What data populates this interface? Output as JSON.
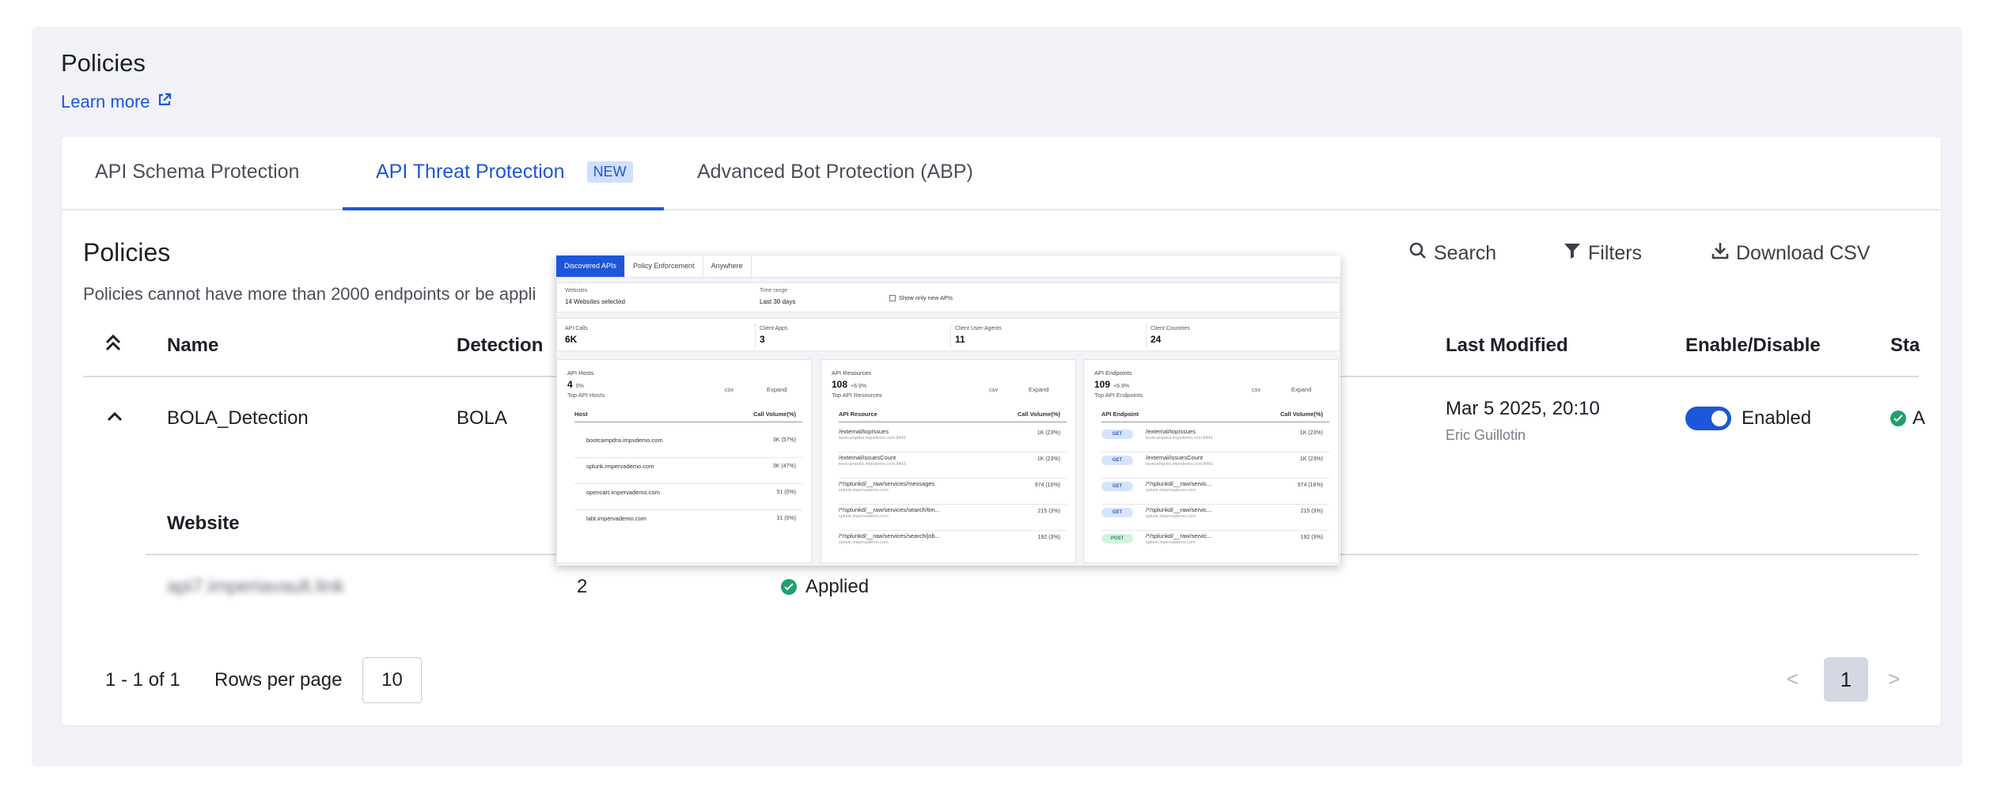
{
  "page": {
    "title": "Policies",
    "learn_more": "Learn more"
  },
  "tabs": [
    {
      "label": "API Schema Protection"
    },
    {
      "label": "API Threat Protection",
      "badge": "NEW"
    },
    {
      "label": "Advanced Bot Protection (ABP)"
    }
  ],
  "section": {
    "title": "Policies",
    "description": "Policies cannot have more than 2000 endpoints or be appli"
  },
  "toolbar": {
    "search": "Search",
    "filters": "Filters",
    "download": "Download CSV"
  },
  "table": {
    "headers": {
      "name": "Name",
      "detection": "Detection",
      "last_modified": "Last Modified",
      "enable": "Enable/Disable",
      "status": "Sta"
    },
    "row": {
      "name": "BOLA_Detection",
      "detection": "BOLA",
      "last_modified": "Mar 5 2025, 20:10",
      "modified_by": "Eric Guillotin",
      "enabled_label": "Enabled",
      "status_partial": "A"
    },
    "sub": {
      "header": "Website",
      "website": "api7.imperiavault.link",
      "count": "2",
      "status": "Applied"
    }
  },
  "pagination": {
    "range": "1 - 1 of 1",
    "rows_label": "Rows per page",
    "rows_value": "10",
    "current_page": "1",
    "prev": "<",
    "next": ">"
  },
  "overlay": {
    "tabs": [
      "Discovered APIs",
      "Policy Enforcement",
      "Anywhere"
    ],
    "filters": {
      "websites_label": "Websites",
      "websites_value": "14 Websites selected",
      "time_label": "Time range",
      "time_value": "Last 30 days",
      "new_only": "Show only new APIs"
    },
    "stats": [
      {
        "label": "API Calls",
        "value": "6K"
      },
      {
        "label": "Client Apps",
        "value": "3"
      },
      {
        "label": "Client User-Agents",
        "value": "11"
      },
      {
        "label": "Client Countries",
        "value": "24"
      }
    ],
    "panels": {
      "hosts": {
        "title": "API Hosts",
        "count": "4",
        "delta": "0%",
        "sub": "Top API Hosts",
        "csv": "csv",
        "expand": "Expand",
        "col1": "Host",
        "col2": "Call Volume(%)",
        "rows": [
          {
            "name": "bootcampdra.impvdemo.com",
            "value": "3K (57%)"
          },
          {
            "name": "splunk.impervademo.com",
            "value": "3K (47%)"
          },
          {
            "name": "opencart.impervademo.com",
            "value": "51 (0%)"
          },
          {
            "name": "labt.impervademo.com",
            "value": "31 (0%)"
          }
        ]
      },
      "resources": {
        "title": "API Resources",
        "count": "108",
        "delta": "+6.9%",
        "sub": "Top API Resources",
        "csv": "csv",
        "expand": "Expand",
        "col1": "API Resource",
        "col2": "Call Volume(%)",
        "rows": [
          {
            "name": "/external/topIssues",
            "host": "bootcampdra.impvdemo.com:8443",
            "value": "1K (23%)"
          },
          {
            "name": "/external/issuesCount",
            "host": "bootcampdra.impvdemo.com:8443",
            "value": "1K (23%)"
          },
          {
            "name": "/*/splunkd/__raw/services/messages",
            "host": "splunk.impervademo.com",
            "value": "974 (16%)"
          },
          {
            "name": "/*/splunkd/__raw/services/search/tim...",
            "host": "splunk.impervademo.com",
            "value": "215 (3%)"
          },
          {
            "name": "/*/splunkd/__raw/services/search/job...",
            "host": "splunk.impervademo.com",
            "value": "192 (3%)"
          }
        ]
      },
      "endpoints": {
        "title": "API Endpoints",
        "count": "109",
        "delta": "+6.9%",
        "sub": "Top API Endpoints",
        "csv": "csv",
        "expand": "Expand",
        "col1": "API Endpoint",
        "col2": "Call Volume(%)",
        "rows": [
          {
            "method": "GET",
            "name": "/external/topIssues",
            "host": "bootcampdra.impvdemo.com:8443",
            "value": "1K (23%)"
          },
          {
            "method": "GET",
            "name": "/external/issuesCount",
            "host": "bootcampdra.impvdemo.com:8443",
            "value": "1K (23%)"
          },
          {
            "method": "GET",
            "name": "/*/splunkd/__raw/servic...",
            "host": "splunk.impervademo.com",
            "value": "974 (16%)"
          },
          {
            "method": "GET",
            "name": "/*/splunkd/__raw/servic...",
            "host": "splunk.impervademo.com",
            "value": "215 (3%)"
          },
          {
            "method": "POST",
            "name": "/*/splunkd/__raw/servic...",
            "host": "splunk.impervademo.com",
            "value": "192 (3%)"
          }
        ]
      }
    }
  },
  "colors": {
    "accent": "#1d56d8",
    "success": "#22a06b"
  },
  "icons": [
    "external-link-icon",
    "search-icon",
    "filter-icon",
    "download-icon",
    "chevron-up-double-icon",
    "chevron-up-icon",
    "check-circle-icon"
  ]
}
